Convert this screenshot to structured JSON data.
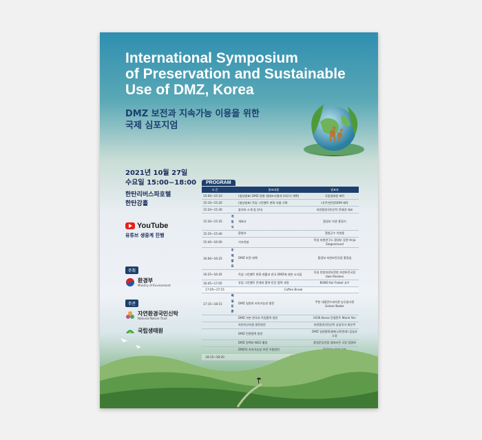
{
  "poster": {
    "title_line1": "International Symposium",
    "title_line2": "of Preservation and Sustainable",
    "title_line3": "Use of DMZ, Korea",
    "ko_title_line1": "DMZ 보전과 지속가능 이용을 위한",
    "ko_title_line2": "국제 심포지엄",
    "date_line1": "2021년 10월 27일",
    "date_line2": "수요일 15:00~18:00",
    "venue_line1": "한탄리버스파호텔",
    "venue_line2": "한탄강홀",
    "youtube_label": "YouTube",
    "youtube_text": "유튜브 생중계 진행",
    "host_tag": "주최",
    "host_name": "환경부",
    "host_sub": "Ministry of Environment",
    "organizer_tag": "주관",
    "organizer_name": "자연환경국민신탁",
    "organizer_sub": "National Nature Trust",
    "partner_name": "국립생태원",
    "program_label": "PROGRAM",
    "columns": {
      "time": "시 간",
      "content": "발표내용",
      "speaker": "발표자"
    },
    "rows": [
      {
        "time": "15:00~15:10",
        "session": "",
        "content": "(영상발표) DMZ 원형 생태조사결과 (비무기 계획)",
        "speaker": "국립생태원 제작"
      },
      {
        "time": "15:10~15:20",
        "session": "",
        "content": "(영상발표) 독일 그린벨트 변화 흐름 기록",
        "speaker": "디(주)한민(DOM 제작"
      },
      {
        "time": "15:20~15:30",
        "session": "",
        "content": "참석자 소개 및 안내",
        "speaker": "자연환경국민신탁 전재경 대표"
      },
      {
        "time": "15:30~15:35",
        "session": "개 회 식",
        "content": "개회사",
        "speaker": "환경부 차관 홍정기"
      },
      {
        "time": "15:35~15:40",
        "session": "",
        "content": "환영사",
        "speaker": "철원군수 이현종"
      },
      {
        "time": "15:40~16:00",
        "session": "",
        "content": "기조연설",
        "speaker": "독일 자원연구소 환경부 장관 Anja Siegesmund"
      },
      {
        "time": "16:00~16:25",
        "session": "주 제 발 표",
        "content": "DMZ 보전 대책",
        "speaker": "환경부 자연보전국장 홍정섭"
      },
      {
        "time": "16:25~16:45",
        "session": "",
        "content": "독일 그린벨트 변화 현황과 한국 DMZ에 대한 시사점",
        "speaker": "독일 연방자연보전청 자연보전국장 Uwe Riecken"
      },
      {
        "time": "16:45~17:05",
        "session": "",
        "content": "유럽 그린벨트 전개와 협력-민간 협력 과정",
        "speaker": "BUND  Kai Frobel  교수"
      },
      {
        "time": "17:05~17:15",
        "session": "",
        "content": "Coffee Break",
        "speaker": "",
        "full": true
      },
      {
        "time": "17:15~18:15",
        "session": "패 널 토 론",
        "content": "DMZ 일원의 지속가능한 발전",
        "speaker": "주한 네덜란드대사관 농무참사관 Gelare Nader"
      },
      {
        "time": "",
        "session": "",
        "content": "DMZ 가본 한국과 독일협력 방안",
        "speaker": "IUCN Korea 컨설턴트 Marie Yon"
      },
      {
        "time": "",
        "session": "",
        "content": "자연유산자원 발전방안",
        "speaker": "자연환경국민신탁 상임이사 최은주"
      },
      {
        "time": "",
        "session": "",
        "content": "DMZ 민관협력 방안",
        "speaker": "DMZ 일원평화생태(시민연대) 김승호 소장"
      },
      {
        "time": "",
        "session": "",
        "content": "DMZ 정책과 NGO 활동",
        "speaker": "환경운동연합 생태보전 국장 정명희"
      },
      {
        "time": "",
        "session": "",
        "content": "DMZ의 지속가능성 보전 이용방안",
        "speaker": "환경일보 문제 기자"
      },
      {
        "time": "18:15~18:20",
        "session": "",
        "content": "폐 회",
        "speaker": "",
        "full": true
      }
    ]
  },
  "colors": {
    "navy": "#1c3f6e",
    "sky": "#2f8fb0",
    "grass": "#5e9a55"
  }
}
